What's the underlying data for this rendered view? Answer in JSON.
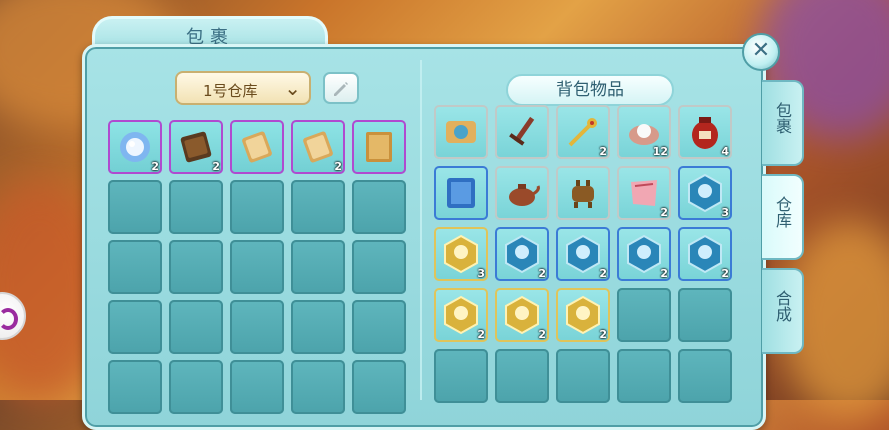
{
  "panel": {
    "title": "包裹"
  },
  "warehouse": {
    "dropdown_label": "1号仓库"
  },
  "backpack": {
    "title": "背包物品"
  },
  "side_tabs": [
    {
      "label": "包裹",
      "active": false
    },
    {
      "label": "仓库",
      "active": true
    },
    {
      "label": "合成",
      "active": false
    }
  ],
  "left_items": [
    {
      "icon": "pearl-flower-icon",
      "count": "2"
    },
    {
      "icon": "dark-tablet-icon",
      "count": "2"
    },
    {
      "icon": "tan-tablet-icon",
      "count": ""
    },
    {
      "icon": "tan-tablet-icon",
      "count": "2"
    },
    {
      "icon": "scroll-sheet-icon",
      "count": ""
    }
  ],
  "right_items": [
    {
      "icon": "scroll-icon",
      "count": ""
    },
    {
      "icon": "sword-icon",
      "count": ""
    },
    {
      "icon": "golden-hairpin-icon",
      "count": "2"
    },
    {
      "icon": "pearl-shell-icon",
      "count": "12"
    },
    {
      "icon": "wine-jar-icon",
      "count": "4"
    },
    {
      "icon": "blue-book-icon",
      "count": ""
    },
    {
      "icon": "teapot-icon",
      "count": ""
    },
    {
      "icon": "bronze-cauldron-icon",
      "count": ""
    },
    {
      "icon": "pink-cloth-icon",
      "count": "2"
    },
    {
      "icon": "blue-hex-badge-icon",
      "count": "3"
    },
    {
      "icon": "gold-hex-badge-icon",
      "count": "3"
    },
    {
      "icon": "blue-hex-badge-icon",
      "count": "2"
    },
    {
      "icon": "blue-hex-badge-icon",
      "count": "2"
    },
    {
      "icon": "blue-hex-badge-icon",
      "count": "2"
    },
    {
      "icon": "blue-hex-badge-icon",
      "count": "2"
    },
    {
      "icon": "gold-hex-badge-icon",
      "count": "2"
    },
    {
      "icon": "gold-hex-badge-icon",
      "count": "2"
    },
    {
      "icon": "gold-hex-badge-icon",
      "count": "2"
    }
  ],
  "badge_counts": {
    "item9": "3",
    "item10": "3",
    "item11": "2",
    "item12": "2",
    "item13": "2",
    "item14": "2",
    "item15": "2",
    "item16": "2",
    "item17": "2"
  },
  "close_icon": "close-icon",
  "edit_icon": "pencil-icon"
}
